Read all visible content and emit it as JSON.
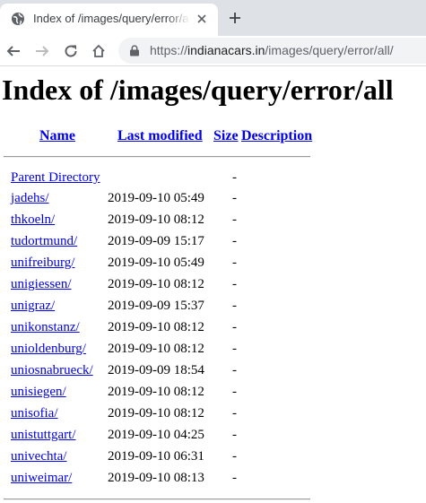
{
  "browser": {
    "tab_title": "Index of /images/query/error/all/",
    "url_scheme": "https://",
    "url_host": "indianacars.in",
    "url_path": "/images/query/error/all/"
  },
  "page": {
    "title": "Index of /images/query/error/all",
    "columns": {
      "name": "Name",
      "last_modified": "Last modified",
      "size": "Size",
      "description": "Description"
    },
    "parent": {
      "name": "Parent Directory",
      "size": "-"
    },
    "rows": [
      {
        "name": "jadehs/",
        "date": "2019-09-10 05:49",
        "size": "-"
      },
      {
        "name": "thkoeln/",
        "date": "2019-09-10 08:12",
        "size": "-"
      },
      {
        "name": "tudortmund/",
        "date": "2019-09-09 15:17",
        "size": "-"
      },
      {
        "name": "unifreiburg/",
        "date": "2019-09-10 05:49",
        "size": "-"
      },
      {
        "name": "unigiessen/",
        "date": "2019-09-10 08:12",
        "size": "-"
      },
      {
        "name": "unigraz/",
        "date": "2019-09-09 15:37",
        "size": "-"
      },
      {
        "name": "unikonstanz/",
        "date": "2019-09-10 08:12",
        "size": "-"
      },
      {
        "name": "unioldenburg/",
        "date": "2019-09-10 08:12",
        "size": "-"
      },
      {
        "name": "uniosnabrueck/",
        "date": "2019-09-09 18:54",
        "size": "-"
      },
      {
        "name": "unisiegen/",
        "date": "2019-09-10 08:12",
        "size": "-"
      },
      {
        "name": "unisofia/",
        "date": "2019-09-10 08:12",
        "size": "-"
      },
      {
        "name": "unistuttgart/",
        "date": "2019-09-10 04:25",
        "size": "-"
      },
      {
        "name": "univechta/",
        "date": "2019-09-10 06:31",
        "size": "-"
      },
      {
        "name": "uniweimar/",
        "date": "2019-09-10 08:13",
        "size": "-"
      }
    ]
  }
}
